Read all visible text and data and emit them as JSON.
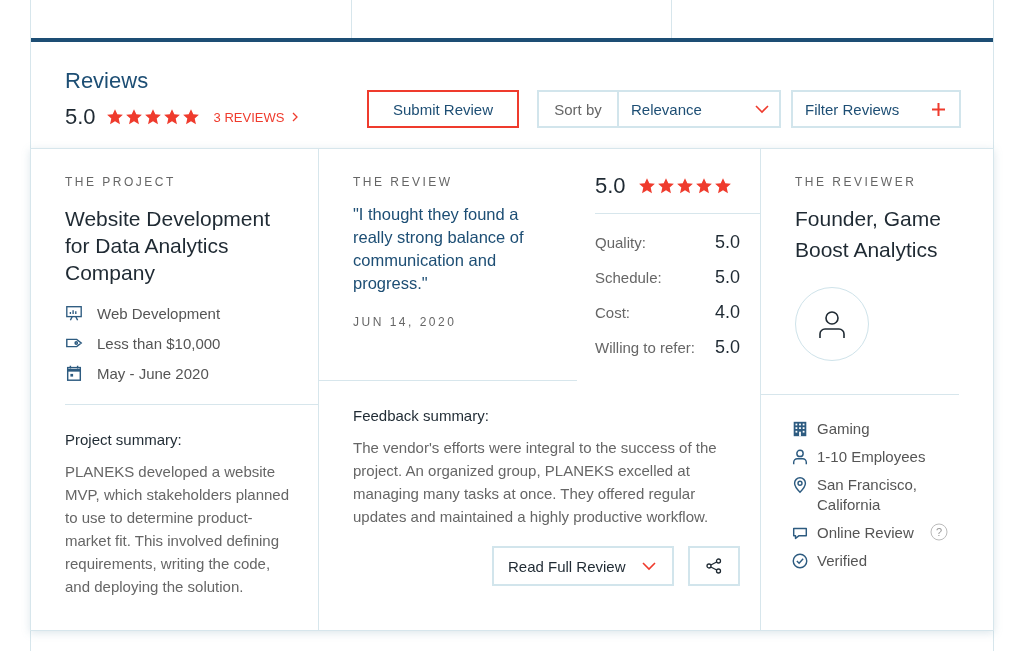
{
  "header": {
    "title": "Reviews",
    "rating": "5.0",
    "stars": 5,
    "reviews_link": "3 REVIEWS"
  },
  "submit_button": "Submit Review",
  "sort": {
    "label": "Sort by",
    "value": "Relevance"
  },
  "filter_button": "Filter Reviews",
  "project": {
    "heading": "THE PROJECT",
    "title": "Website Development for Data Analytics Company",
    "details": [
      {
        "kind": "service",
        "text": "Web Development"
      },
      {
        "kind": "budget",
        "text": "Less than $10,000"
      },
      {
        "kind": "dates",
        "text": "May - June 2020"
      }
    ],
    "summary_label": "Project summary:",
    "summary": "PLANEKS developed a website MVP, which stakeholders planned to use to determine product-market fit. This involved defining requirements, writing the code, and deploying the solution."
  },
  "review": {
    "heading": "THE REVIEW",
    "quote": "\"I thought they found a really strong balance of communication and progress.\"",
    "date": "JUN 14, 2020",
    "rating": "5.0",
    "stars": 5,
    "scores": [
      {
        "label": "Quality:",
        "value": "5.0"
      },
      {
        "label": "Schedule:",
        "value": "5.0"
      },
      {
        "label": "Cost:",
        "value": "4.0"
      },
      {
        "label": "Willing to refer:",
        "value": "5.0"
      }
    ],
    "feedback_label": "Feedback summary:",
    "feedback": "The vendor's efforts were integral to the success of the project. An organized group, PLANEKS excelled at managing many tasks at once. They offered regular updates and maintained a highly productive workflow.",
    "read_button": "Read Full Review"
  },
  "reviewer": {
    "heading": "THE REVIEWER",
    "title": "Founder, Game Boost Analytics",
    "details": [
      {
        "kind": "industry",
        "text": "Gaming"
      },
      {
        "kind": "size",
        "text": "1-10 Employees"
      },
      {
        "kind": "location",
        "text": "San Francisco, California"
      },
      {
        "kind": "source",
        "text": "Online Review",
        "help_icon": "?"
      },
      {
        "kind": "verified",
        "text": "Verified"
      }
    ]
  }
}
